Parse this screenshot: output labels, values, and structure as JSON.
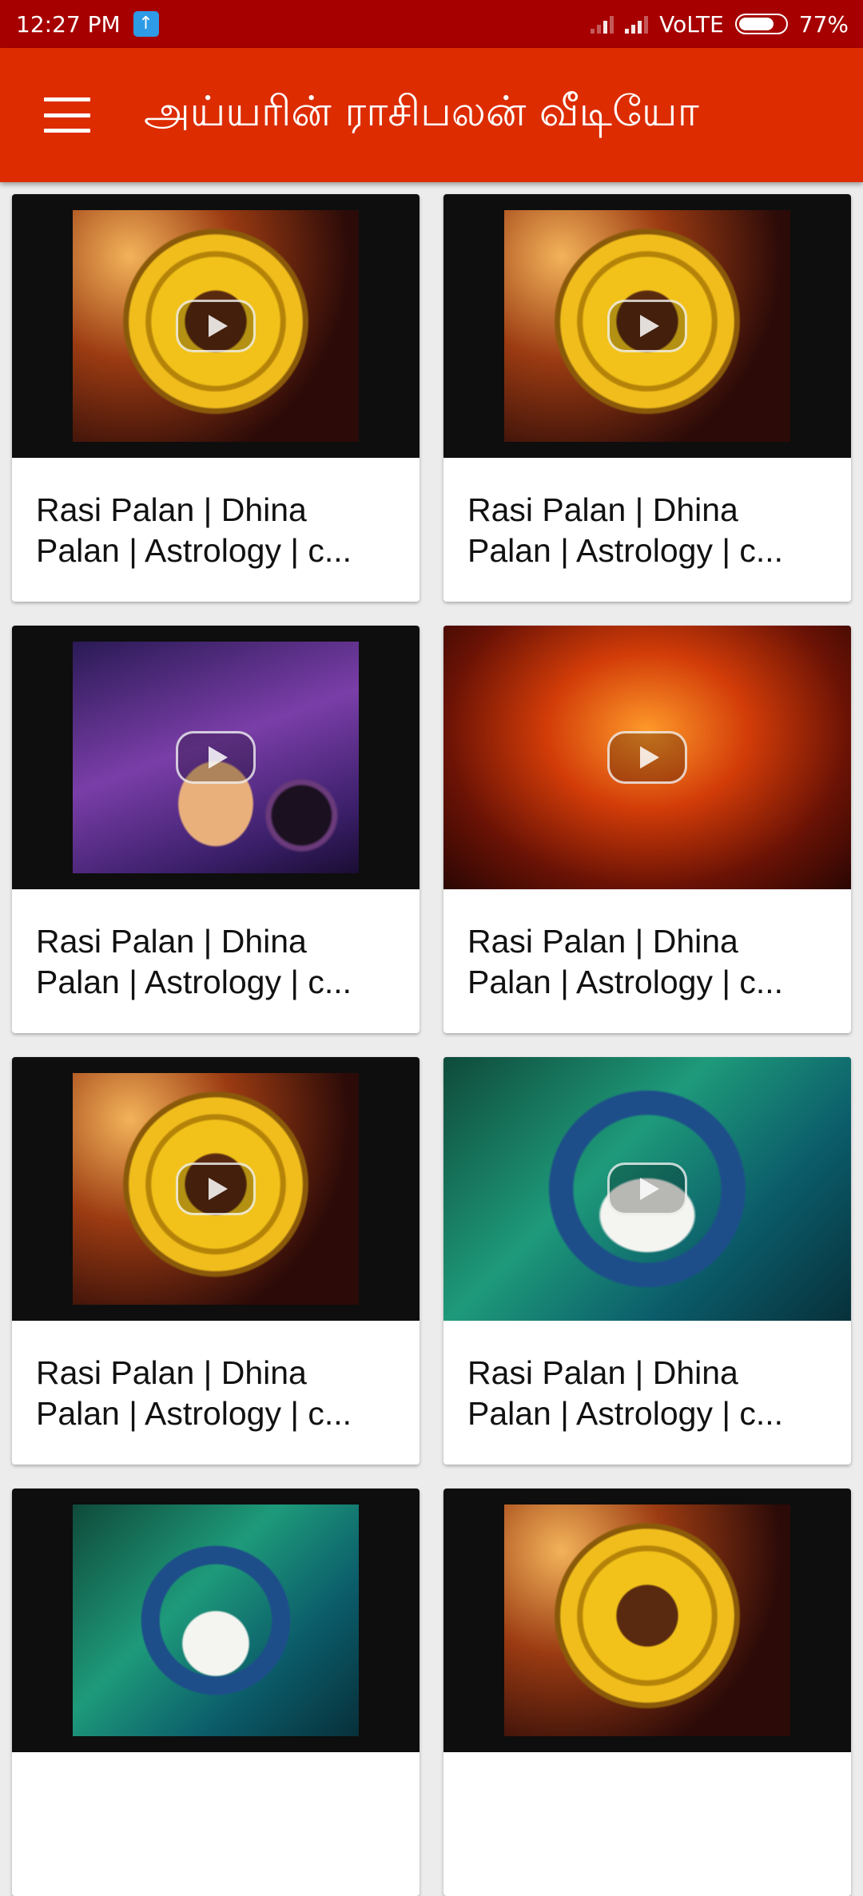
{
  "status_bar": {
    "time": "12:27 PM",
    "network": "VoLTE",
    "battery": "77%",
    "battery_level": 0.77,
    "icons": [
      "upload-icon",
      "signal-icon",
      "signal-icon",
      "battery-icon"
    ]
  },
  "app_bar": {
    "title": "அய்யரின் ராசிபலன் வீடியோ",
    "menu_icon": "hamburger-menu-icon"
  },
  "videos": [
    {
      "title": "Rasi Palan | Dhina Palan | Astrology | c...",
      "thumbnail": "zodiac-wheel-thumbnail",
      "play_icon": "play-icon"
    },
    {
      "title": "Rasi Palan | Dhina Palan | Astrology | c...",
      "thumbnail": "zodiac-wheel-thumbnail",
      "play_icon": "play-icon"
    },
    {
      "title": "Rasi Palan | Dhina Palan | Astrology | c...",
      "thumbnail": "astrologer-thumbnail",
      "play_icon": "play-icon"
    },
    {
      "title": "Rasi Palan | Dhina Palan | Astrology | c...",
      "thumbnail": "jothida-thagaval-thumbnail",
      "play_icon": "play-icon"
    },
    {
      "title": "Rasi Palan | Dhina Palan | Astrology | c...",
      "thumbnail": "zodiac-wheel-thumbnail",
      "play_icon": "play-icon"
    },
    {
      "title": "Rasi Palan | Dhina Palan | Astrology | c...",
      "thumbnail": "simmam-astrologer-thumbnail",
      "play_icon": "play-icon"
    },
    {
      "title": "",
      "thumbnail": "astrologer-thumbnail",
      "play_icon": "play-icon"
    },
    {
      "title": "",
      "thumbnail": "zodiac-wheel-thumbnail",
      "play_icon": "play-icon"
    }
  ],
  "colors": {
    "status_bar": "#a60000",
    "app_bar": "#dd2c00",
    "background": "#ececec",
    "card": "#ffffff"
  }
}
